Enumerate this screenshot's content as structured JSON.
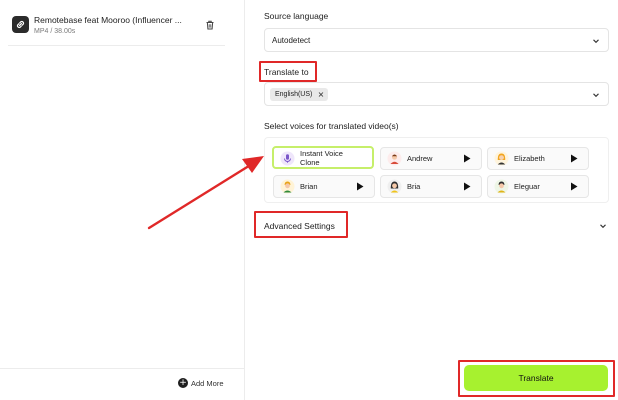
{
  "file": {
    "name": "Remotebase feat Mooroo (Influencer ...",
    "meta": "MP4 / 38.00s",
    "icon": "link-icon"
  },
  "left_footer": {
    "add_more_label": "Add More"
  },
  "source_language": {
    "label": "Source language",
    "value": "Autodetect"
  },
  "translate_to": {
    "label": "Translate to",
    "selected": [
      "English(US)"
    ]
  },
  "voices": {
    "label": "Select voices for translated video(s)",
    "items": [
      {
        "name": "Instant Voice Clone",
        "selected": true
      },
      {
        "name": "Andrew",
        "selected": false
      },
      {
        "name": "Elizabeth",
        "selected": false
      },
      {
        "name": "Brian",
        "selected": false
      },
      {
        "name": "Bria",
        "selected": false
      },
      {
        "name": "Eleguar",
        "selected": false
      }
    ]
  },
  "advanced_settings": {
    "label": "Advanced Settings"
  },
  "actions": {
    "translate_label": "Translate"
  },
  "colors": {
    "accent_green": "#a7f12f",
    "selected_border": "#c6ef6a",
    "annotation_red": "#e02828"
  }
}
